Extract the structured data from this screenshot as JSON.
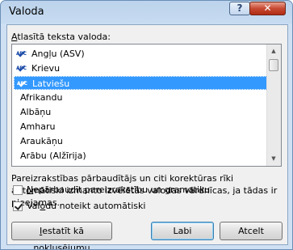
{
  "window": {
    "title": "Valoda"
  },
  "titlebar": {
    "help_glyph": "?",
    "close_glyph": "✕"
  },
  "list_label": {
    "accel": "A",
    "rest": "tlasītā teksta valoda:"
  },
  "languages": [
    {
      "label": "Angļu (ASV)",
      "spell_icon": true,
      "selected": false
    },
    {
      "label": "Krievu",
      "spell_icon": true,
      "selected": false
    },
    {
      "label": "Latviešu",
      "spell_icon": true,
      "selected": true
    },
    {
      "label": "Afrikandu",
      "spell_icon": false,
      "selected": false
    },
    {
      "label": "Albāņu",
      "spell_icon": false,
      "selected": false
    },
    {
      "label": "Amharu",
      "spell_icon": false,
      "selected": false
    },
    {
      "label": "Araukāņu",
      "spell_icon": false,
      "selected": false
    },
    {
      "label": "Arābu (Alžīrija)",
      "spell_icon": false,
      "selected": false
    }
  ],
  "spell_icon_text": "ABC",
  "description": "Pareizrakstības pārbaudītājs un citi korektūras rīki automātiski izmanto izvēlētās valodas vārdnīcas, ja tādas ir pieejamas.",
  "checkboxes": {
    "no_proof": {
      "accel": "N",
      "rest": "epārbaudīt pareizrakstību un gramatiku",
      "checked": false
    },
    "detect": {
      "pre": "Val",
      "accel": "o",
      "rest": "du noteikt automātiski",
      "checked": true
    }
  },
  "buttons": {
    "set_default": {
      "accel": "I",
      "rest": "estatīt kā noklusējumu"
    },
    "ok": "Labi",
    "cancel": "Atcelt"
  },
  "scrollbar": {
    "up": "▲",
    "down": "▼"
  }
}
